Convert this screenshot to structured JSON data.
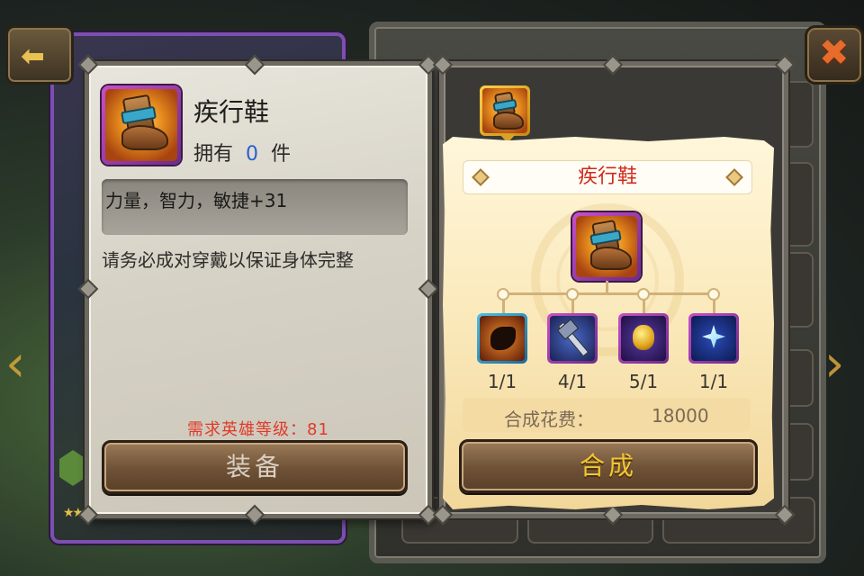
{
  "item": {
    "name": "疾行鞋",
    "owned_prefix": "拥有",
    "owned_count": "0",
    "owned_suffix": "件",
    "stats": "力量，智力，敏捷+31",
    "description": "请务必成对穿戴以保证身体完整",
    "requirement": "需求英雄等级：81",
    "equip_label": "装备"
  },
  "craft": {
    "title": "疾行鞋",
    "materials": [
      {
        "icon": "shadow-cloak-icon",
        "count": "1/1"
      },
      {
        "icon": "blade-hammer-icon",
        "count": "4/1"
      },
      {
        "icon": "golden-idol-icon",
        "count": "5/1"
      },
      {
        "icon": "ice-spear-icon",
        "count": "1/1"
      }
    ],
    "cost_label": "合成花费：",
    "cost_value": "18000",
    "craft_label": "合成"
  },
  "colors": {
    "rare_frame": "#c84fc8",
    "legend_frame": "#ffd24a",
    "accent_text": "#d02a1a",
    "requirement_text": "#e03a2a",
    "owned_count_text": "#2a5fd0",
    "craft_button_text": "#f2c531"
  }
}
